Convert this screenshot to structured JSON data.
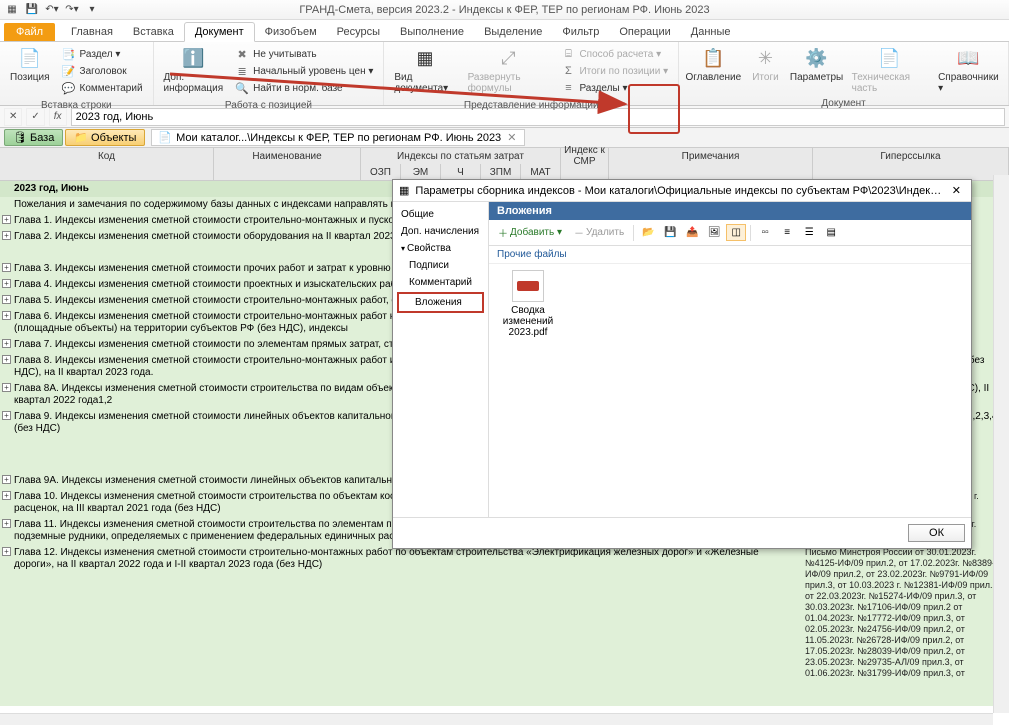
{
  "app_title": "ГРАНД-Смета, версия 2023.2 - Индексы к ФЕР, ТЕР по регионам РФ. Июнь 2023",
  "file_tab": "Файл",
  "ribbon_tabs": [
    "Главная",
    "Вставка",
    "Документ",
    "Физобъем",
    "Ресурсы",
    "Выполнение",
    "Выделение",
    "Фильтр",
    "Операции",
    "Данные"
  ],
  "active_tab": 2,
  "groups": {
    "g1": {
      "title": "Вставка строки",
      "big": "Позиция",
      "items": [
        "Раздел ▾",
        "Заголовок",
        "Комментарий"
      ]
    },
    "g2": {
      "title": "Работа с позицией",
      "big": "Доп. информация",
      "items": [
        "Не учитывать",
        "Начальный уровень цен ▾",
        "Найти в норм. базе"
      ]
    },
    "g3": {
      "title": "Представление информации",
      "big1": "Вид документа▾",
      "big2": "Развернуть формулы",
      "items": [
        "Способ расчета ▾",
        "Итоги по позиции ▾",
        "Разделы ▾"
      ]
    },
    "g4": {
      "title": "Документ",
      "b1": "Оглавление",
      "b2": "Итоги",
      "b3": "Параметры",
      "b4": "Техническая часть",
      "b5": "Справочники ▾"
    }
  },
  "formula_val": "2023 год, Июнь",
  "nav": {
    "base": "База",
    "objects": "Объекты",
    "tab": "Мои каталог...\\Индексы к ФЕР, ТЕР по регионам РФ. Июнь 2023",
    "close": "✕"
  },
  "thead": {
    "code": "Код",
    "name": "Наименование",
    "idx": "Индексы по статьям затрат",
    "smr": "Индекс к СМР",
    "note": "Примечания",
    "hyp": "Гиперссылка",
    "subs": [
      "ОЗП",
      "ЭМ",
      "Ч",
      "ЗПМ",
      "МАТ"
    ]
  },
  "rows": {
    "title": "2023 год, Июнь",
    "r0": "Пожелания и замечания по содержимому базы данных с индексами направлять в ООО \"ЭС",
    "r1": "Глава 1. Индексы изменения сметной стоимости строительно-монтажных и пусконаладочн определяемых с применением федеральных и территориальных единичных расценок",
    "r2": "Глава 2. Индексы изменения сметной стоимости оборудования на II квартал 2023 года",
    "r3": "Глава 3. Индексы изменения сметной стоимости прочих работ и затрат к уровню цен по со",
    "r4": "Глава 4. Индексы изменения сметной стоимости проектных и изыскательских работ на II к",
    "r5": "Глава 5. Индексы изменения сметной стоимости строительно-монтажных работ, определяе нормативной базы ОСНБЖ-2001 на I квартал 2023 года (1) (без НДС)",
    "r6": "Глава 6. Индексы изменения сметной стоимости строительно-монтажных работ на объект нефти и нефтепродуктов (линейная часть, резервуарные парки) и сооружений, участвующ нефтепродуктов (площадные объекты) на территории субъектов РФ (без НДС), индексы",
    "r7": "Глава 7. Индексы изменения сметной стоимости по элементам прямых затрат, строительн объектах использования атомной энергии, определяемых с применением федеральных ед года.",
    "r8": "Глава 8. Индексы изменения сметной стоимости строительно-монтажных работ и по элемен \"Автомобильные дороги\" и \"Искусственные дорожные сооружения для автомобильных д единичных расценок (без НДС), на II квартал 2023 года.",
    "r8a": "Глава 8А. Индексы изменения сметной стоимости строительства по видам объектов строи \"Скоростные автомобильные дороги (категории IБ)\", строительство которых осуществля 2001/ТЕР-2001, (без НДС), II квартал 2022 года1,2",
    "r9": "Глава 9. Индексы изменения сметной стоимости линейных объектов капитального строите воздушных линий электропередач к сметно-нормативной базе ФЕР-2001 на II квартал и на II квартал 2022 года (1,2,3,4) (без НДС)",
    "r9a": "Глава 9А. Индексы изменения сметной стоимости линейных объектов капитального строи строительство которых осуществляется ПАО «Россети», с применением федеральных ед НДС)",
    "r10": "Глава 10. Индексы изменения сметной стоимости строительства по объектам космической отрасли, определяемые с применением федеральных единичных расценок, на III квартал 2021 года (без НДС)",
    "r10n": "Письмо Минстроя России от 09.10.2021 г. №43557-ИФ/09",
    "r11": "Глава 11. Индексы изменения сметной стоимости строительства по элементам прямых затрат по объектам строительства алмазодобывающей промышленности, подземные  рудники, определяемых с применением федеральных единичных расценок, на II квартал",
    "r11n": "Письмо Минстроя России от 01.06.2023г. №31799-ИФ/09 прил.5",
    "r12": "Глава 12. Индексы изменения сметной стоимости строительно-монтажных работ по объектам строительства «Электрификация железных дорог» и «Железные дороги», на II квартал 2022 года и I-II квартал 2023 года (без НДС)",
    "r12n": "Письмо Минстроя России от 30.01.2023г. №4125-ИФ/09 прил.2, от 17.02.2023г. №8389-ИФ/09 прил.2, от 23.02.2023г. №9791-ИФ/09 прил.3, от 10.03.2023 г. №12381-ИФ/09 прил.2, от 22.03.2023г. №15274-ИФ/09 прил.3, от 30.03.2023г. №17106-ИФ/09 прил.2 от 01.04.2023г. №17772-ИФ/09 прил.3, от 02.05.2023г. №24756-ИФ/09 прил.2, от 11.05.2023г. №26728-ИФ/09 прил.2, от 17.05.2023г. №28039-ИФ/09 прил.2, от 23.05.2023г. №29735-АЛ/09 прил.3, от 01.06.2023г. №31799-ИФ/09 прил.3, от"
  },
  "modal": {
    "title": "Параметры сборника индексов - Мои каталоги\\Официальные индексы по субъектам РФ\\2023\\Индексы к ФЕР, ТЕР по регионам Р...",
    "side": [
      "Общие",
      "Доп. начисления",
      "Свойства",
      "Подписи",
      "Комментарий",
      "Вложения"
    ],
    "main_head": "Вложения",
    "tb_add": "Добавить ▾",
    "tb_del": "Удалить",
    "cat": "Прочие файлы",
    "file": "Сводка изменений 2023.pdf",
    "ok": "ОК"
  }
}
